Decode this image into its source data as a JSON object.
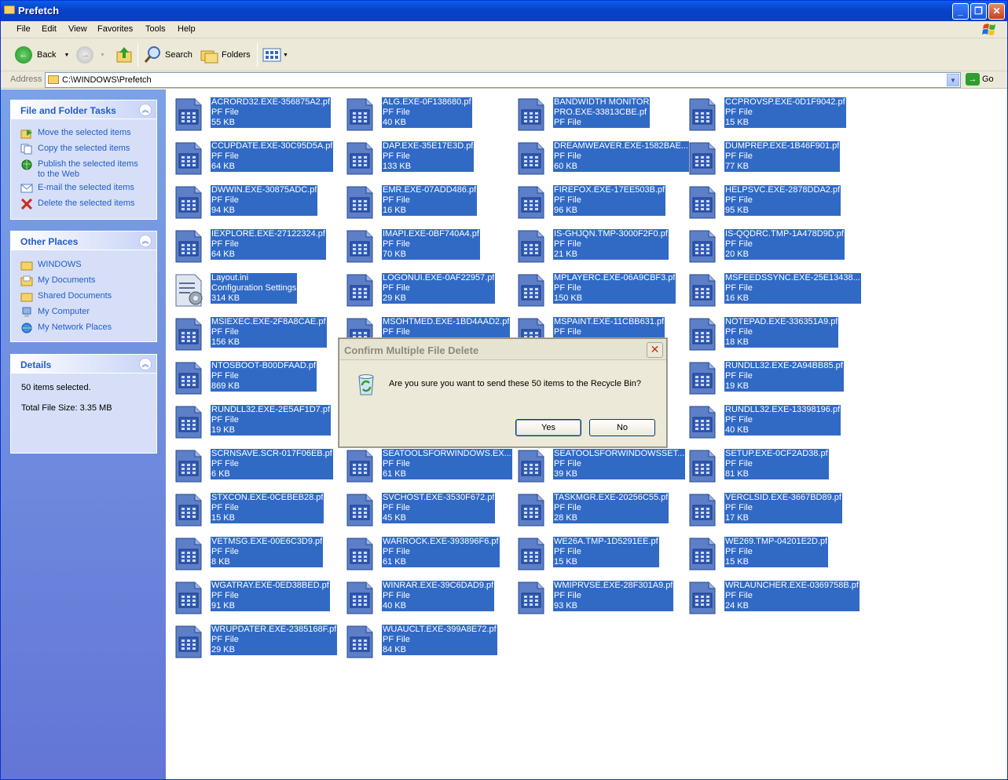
{
  "window": {
    "title": "Prefetch",
    "controls": [
      "minimize-icon",
      "maximize-icon",
      "close-icon"
    ]
  },
  "menu": [
    "File",
    "Edit",
    "View",
    "Favorites",
    "Tools",
    "Help"
  ],
  "toolbar": {
    "back_label": "Back",
    "search_label": "Search",
    "folders_label": "Folders"
  },
  "address": {
    "label": "Address",
    "value": "C:\\WINDOWS\\Prefetch",
    "go_label": "Go"
  },
  "tasks": {
    "title": "File and Folder Tasks",
    "items": [
      {
        "label": "Move the selected items",
        "icon": "move-icon"
      },
      {
        "label": "Copy the selected items",
        "icon": "copy-icon"
      },
      {
        "label": "Publish the selected items",
        "label2": "to the Web",
        "icon": "web-publish-icon"
      },
      {
        "label": "E-mail the selected items",
        "icon": "email-icon"
      },
      {
        "label": "Delete the selected items",
        "icon": "delete-icon"
      }
    ]
  },
  "places": {
    "title": "Other Places",
    "items": [
      {
        "label": "WINDOWS",
        "icon": "folder-icon"
      },
      {
        "label": "My Documents",
        "icon": "folder-icon"
      },
      {
        "label": "Shared Documents",
        "icon": "folder-icon"
      },
      {
        "label": "My Computer",
        "icon": "computer-icon"
      },
      {
        "label": "My Network Places",
        "icon": "network-icon"
      }
    ]
  },
  "details": {
    "title": "Details",
    "selected": "50 items selected.",
    "total": "Total File Size: 3.35 MB"
  },
  "files": [
    {
      "name": "ACRORD32.EXE-356875A2.pf",
      "type": "PF File",
      "size": "55 KB"
    },
    {
      "name": "ALG.EXE-0F138680.pf",
      "type": "PF File",
      "size": "40 KB"
    },
    {
      "name": "BANDWIDTH MONITOR",
      "name2": "PRO.EXE-33813CBE.pf",
      "type": "PF File"
    },
    {
      "name": "CCPROVSP.EXE-0D1F9042.pf",
      "type": "PF File",
      "size": "15 KB"
    },
    {
      "name": "CCUPDATE.EXE-30C95D5A.pf",
      "type": "PF File",
      "size": "64 KB"
    },
    {
      "name": "DAP.EXE-35E17E3D.pf",
      "type": "PF File",
      "size": "133 KB"
    },
    {
      "name": "DREAMWEAVER.EXE-1582BAE...",
      "type": "PF File",
      "size": "60 KB"
    },
    {
      "name": "DUMPREP.EXE-1B46F901.pf",
      "type": "PF File",
      "size": "77 KB"
    },
    {
      "name": "DWWIN.EXE-30875ADC.pf",
      "type": "PF File",
      "size": "94 KB"
    },
    {
      "name": "EMR.EXE-07ADD486.pf",
      "type": "PF File",
      "size": "16 KB"
    },
    {
      "name": "FIREFOX.EXE-17EE503B.pf",
      "type": "PF File",
      "size": "96 KB"
    },
    {
      "name": "HELPSVC.EXE-2878DDA2.pf",
      "type": "PF File",
      "size": "95 KB"
    },
    {
      "name": "IEXPLORE.EXE-27122324.pf",
      "type": "PF File",
      "size": "64 KB"
    },
    {
      "name": "IMAPI.EXE-0BF740A4.pf",
      "type": "PF File",
      "size": "70 KB"
    },
    {
      "name": "IS-GHJQN.TMP-3000F2F0.pf",
      "type": "PF File",
      "size": "21 KB"
    },
    {
      "name": "IS-QQDRC.TMP-1A478D9D.pf",
      "type": "PF File",
      "size": "20 KB"
    },
    {
      "name": "Layout.ini",
      "type": "Configuration Settings",
      "size": "314 KB",
      "config": true
    },
    {
      "name": "LOGONUI.EXE-0AF22957.pf",
      "type": "PF File",
      "size": "29 KB"
    },
    {
      "name": "MPLAYERC.EXE-06A9CBF3.pf",
      "type": "PF File",
      "size": "150 KB"
    },
    {
      "name": "MSFEEDSSYNC.EXE-25E13438...",
      "type": "PF File",
      "size": "16 KB"
    },
    {
      "name": "MSIEXEC.EXE-2F8A8CAE.pf",
      "type": "PF File",
      "size": "156 KB"
    },
    {
      "name": "MSOHTMED.EXE-1BD4AAD2.pf",
      "type": "PF File"
    },
    {
      "name": "MSPAINT.EXE-11CBB631.pf",
      "type": "PF File"
    },
    {
      "name": "NOTEPAD.EXE-336351A9.pf",
      "type": "PF File",
      "size": "18 KB"
    },
    {
      "name": "NTOSBOOT-B00DFAAD.pf",
      "type": "PF File",
      "size": "869 KB"
    },
    {
      "hidden": true
    },
    {
      "hidden": true
    },
    {
      "name": "RUNDLL32.EXE-2A94BB85.pf",
      "type": "PF File",
      "size": "19 KB"
    },
    {
      "name": "RUNDLL32.EXE-2E5AF1D7.pf",
      "type": "PF File",
      "size": "19 KB"
    },
    {
      "hidden": true
    },
    {
      "hidden": true
    },
    {
      "name": "RUNDLL32.EXE-13398196.pf",
      "type": "PF File",
      "size": "40 KB"
    },
    {
      "name": "SCRNSAVE.SCR-017F06EB.pf",
      "type": "PF File",
      "size": "6 KB"
    },
    {
      "name": "SEATOOLSFORWINDOWS.EX...",
      "type": "PF File",
      "size": "61 KB"
    },
    {
      "name": "SEATOOLSFORWINDOWSSET...",
      "type": "PF File",
      "size": "39 KB"
    },
    {
      "name": "SETUP.EXE-0CF2AD38.pf",
      "type": "PF File",
      "size": "81 KB"
    },
    {
      "name": "STXCON.EXE-0CEBEB28.pf",
      "type": "PF File",
      "size": "15 KB"
    },
    {
      "name": "SVCHOST.EXE-3530F672.pf",
      "type": "PF File",
      "size": "45 KB"
    },
    {
      "name": "TASKMGR.EXE-20256C55.pf",
      "type": "PF File",
      "size": "28 KB"
    },
    {
      "name": "VERCLSID.EXE-3667BD89.pf",
      "type": "PF File",
      "size": "17 KB"
    },
    {
      "name": "VETMSG.EXE-00E6C3D9.pf",
      "type": "PF File",
      "size": "8 KB"
    },
    {
      "name": "WARROCK.EXE-393896F6.pf",
      "type": "PF File",
      "size": "61 KB"
    },
    {
      "name": "WE26A.TMP-1D5291EE.pf",
      "type": "PF File",
      "size": "15 KB"
    },
    {
      "name": "WE269.TMP-04201E2D.pf",
      "type": "PF File",
      "size": "15 KB"
    },
    {
      "name": "WGATRAY.EXE-0ED38BED.pf",
      "type": "PF File",
      "size": "91 KB"
    },
    {
      "name": "WINRAR.EXE-39C6DAD9.pf",
      "type": "PF File",
      "size": "40 KB"
    },
    {
      "name": "WMIPRVSE.EXE-28F301A9.pf",
      "type": "PF File",
      "size": "93 KB"
    },
    {
      "name": "WRLAUNCHER.EXE-0369758B.pf",
      "type": "PF File",
      "size": "24 KB"
    },
    {
      "name": "WRUPDATER.EXE-2385168F.pf",
      "type": "PF File",
      "size": "29 KB"
    },
    {
      "name": "WUAUCLT.EXE-399A8E72.pf",
      "type": "PF File",
      "size": "84 KB"
    }
  ],
  "dialog": {
    "title": "Confirm Multiple File Delete",
    "message": "Are you sure you want to send these 50 items to the Recycle Bin?",
    "yes": "Yes",
    "no": "No",
    "icon": "recycle-bin-icon"
  },
  "colors": {
    "selection": "#316ac5",
    "titlebar": "#0842c8",
    "taskpane": "#6375d6"
  }
}
